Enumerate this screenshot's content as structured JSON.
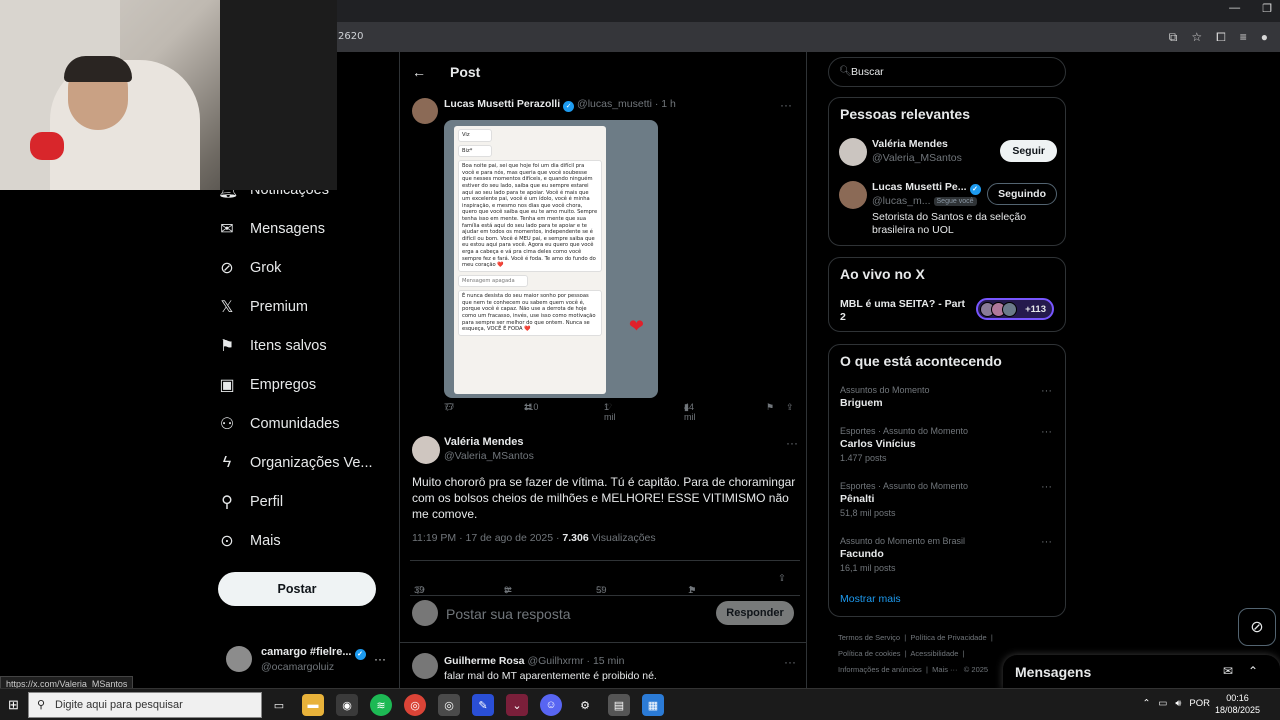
{
  "browser": {
    "url_fragment": "2620",
    "status_url": "https://x.com/Valeria_MSantos"
  },
  "nav": {
    "items": [
      {
        "label": "Notificações",
        "icon": "bell-icon"
      },
      {
        "label": "Mensagens",
        "icon": "mail-icon"
      },
      {
        "label": "Grok",
        "icon": "grok-icon"
      },
      {
        "label": "Premium",
        "icon": "x-logo-icon"
      },
      {
        "label": "Itens salvos",
        "icon": "bookmark-icon"
      },
      {
        "label": "Empregos",
        "icon": "briefcase-icon"
      },
      {
        "label": "Comunidades",
        "icon": "people-icon"
      },
      {
        "label": "Organizações Ve...",
        "icon": "lightning-icon"
      },
      {
        "label": "Perfil",
        "icon": "person-icon"
      },
      {
        "label": "Mais",
        "icon": "more-circle-icon"
      }
    ],
    "post_button": "Postar",
    "account": {
      "name": "camargo #fielre...",
      "handle": "@ocamargoluiz"
    }
  },
  "main": {
    "header_title": "Post",
    "quoted": {
      "name": "Lucas Musetti Perazolli",
      "handle": "@lucas_musetti",
      "time": "· 1 h",
      "image_texts": [
        "Viz",
        "Biz*",
        "Boa noite pai, sei que hoje foi um dia difícil pra você e para nós, mas queria que você soubesse que nesses momentos difíceis, e quando ninguém estiver do seu lado, saiba que eu sempre estarei aqui ao seu lado para te apoiar. Você é mais que um excelente pai, você é um ídolo, você é minha inspiração, e mesmo nos dias que você chora, quero que você saiba que eu te amo muito. Sempre tenha isso em mente. Tenha em mente que sua família está aqui do seu lado para te apoiar e te ajudar em todos os momentos, independente se é difícil ou bom. Você é MEU pai, e sempre saiba que eu estou aqui para você. Agora eu quero que você erga a cabeça e vá pra cima deles como você sempre fez e fará. Você é foda. Te amo do fundo do meu coração ❤️",
        "Mensagem apagada",
        "É nunca desista do seu maior sonho por pessoas que nem te conhecem ou sabem quem você é, porque você é capaz. Não use a derrota de hoje como um fracasso, invés, use isso como motivação para sempre ser melhor do que ontem. Nunca se esqueça, VOCÊ É FODA ❤️"
      ],
      "replies": "77",
      "reposts": "110",
      "likes": "1 mil",
      "views": "44 mil"
    },
    "reply": {
      "name": "Valéria Mendes",
      "handle": "@Valeria_MSantos",
      "text": "Muito chororô pra se fazer de vítima. Tú é capitão.  Para de choramingar com os bolsos cheios de milhões e MELHORE! ESSE VITIMISMO não me comove.",
      "timestamp": "11:19 PM · 17 de ago de 2025 · ",
      "views_count": "7.306",
      "views_label": " Visualizações",
      "replies": "39",
      "reposts": "9",
      "likes": "59",
      "bookmarks": "1"
    },
    "composer": {
      "placeholder": "Postar sua resposta",
      "button": "Responder"
    },
    "next_reply": {
      "name": "Guilherme Rosa",
      "handle": "@Guilhxrmr",
      "time": "· 15 min",
      "text": "falar mal do MT aparentemente é proibido né."
    }
  },
  "right": {
    "search_placeholder": "Buscar",
    "relevant": {
      "title": "Pessoas relevantes",
      "people": [
        {
          "name": "Valéria Mendes",
          "handle": "@Valeria_MSantos",
          "button": "Seguir"
        },
        {
          "name": "Lucas Musetti Pe...",
          "handle": "@lucas_m...",
          "follows_you": "Segue você",
          "bio": "Setorista do Santos e da seleção brasileira no UOL",
          "button": "Seguindo"
        }
      ]
    },
    "live": {
      "title": "Ao vivo no X",
      "text": "MBL é uma SEITA? - Part 2",
      "count": "+113"
    },
    "trends": {
      "title": "O que está acontecendo",
      "items": [
        {
          "context": "Assuntos do Momento",
          "name": "Briguem",
          "posts": ""
        },
        {
          "context": "Esportes · Assunto do Momento",
          "name": "Carlos Vinícius",
          "posts": "1.477 posts"
        },
        {
          "context": "Esportes · Assunto do Momento",
          "name": "Pênalti",
          "posts": "51,8 mil posts"
        },
        {
          "context": "Assunto do Momento em Brasil",
          "name": "Facundo",
          "posts": "16,1 mil posts"
        }
      ],
      "show_more": "Mostrar mais"
    },
    "footer": {
      "terms": "Termos de Serviço",
      "privacy": "Política de Privacidade",
      "cookies": "Política de cookies",
      "accessibility": "Acessibilidade",
      "ads": "Informações de anúncios",
      "more": "Mais ···",
      "copyright": "© 2025"
    }
  },
  "messages_drawer": {
    "title": "Mensagens"
  },
  "taskbar": {
    "search_placeholder": "Digite aqui para pesquisar",
    "lang": "POR",
    "time": "00:16",
    "date": "18/08/2025"
  }
}
